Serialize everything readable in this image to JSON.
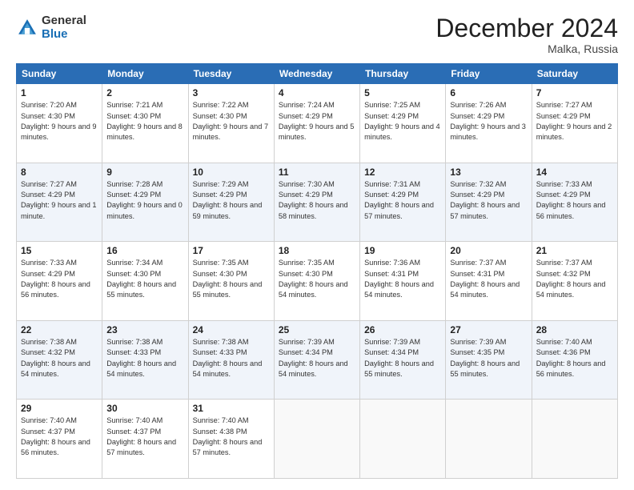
{
  "logo": {
    "general": "General",
    "blue": "Blue"
  },
  "header": {
    "title": "December 2024",
    "location": "Malka, Russia"
  },
  "weekdays": [
    "Sunday",
    "Monday",
    "Tuesday",
    "Wednesday",
    "Thursday",
    "Friday",
    "Saturday"
  ],
  "weeks": [
    [
      {
        "day": "1",
        "sunrise": "7:20 AM",
        "sunset": "4:30 PM",
        "daylight": "9 hours and 9 minutes."
      },
      {
        "day": "2",
        "sunrise": "7:21 AM",
        "sunset": "4:30 PM",
        "daylight": "9 hours and 8 minutes."
      },
      {
        "day": "3",
        "sunrise": "7:22 AM",
        "sunset": "4:30 PM",
        "daylight": "9 hours and 7 minutes."
      },
      {
        "day": "4",
        "sunrise": "7:24 AM",
        "sunset": "4:29 PM",
        "daylight": "9 hours and 5 minutes."
      },
      {
        "day": "5",
        "sunrise": "7:25 AM",
        "sunset": "4:29 PM",
        "daylight": "9 hours and 4 minutes."
      },
      {
        "day": "6",
        "sunrise": "7:26 AM",
        "sunset": "4:29 PM",
        "daylight": "9 hours and 3 minutes."
      },
      {
        "day": "7",
        "sunrise": "7:27 AM",
        "sunset": "4:29 PM",
        "daylight": "9 hours and 2 minutes."
      }
    ],
    [
      {
        "day": "8",
        "sunrise": "7:27 AM",
        "sunset": "4:29 PM",
        "daylight": "9 hours and 1 minute."
      },
      {
        "day": "9",
        "sunrise": "7:28 AM",
        "sunset": "4:29 PM",
        "daylight": "9 hours and 0 minutes."
      },
      {
        "day": "10",
        "sunrise": "7:29 AM",
        "sunset": "4:29 PM",
        "daylight": "8 hours and 59 minutes."
      },
      {
        "day": "11",
        "sunrise": "7:30 AM",
        "sunset": "4:29 PM",
        "daylight": "8 hours and 58 minutes."
      },
      {
        "day": "12",
        "sunrise": "7:31 AM",
        "sunset": "4:29 PM",
        "daylight": "8 hours and 57 minutes."
      },
      {
        "day": "13",
        "sunrise": "7:32 AM",
        "sunset": "4:29 PM",
        "daylight": "8 hours and 57 minutes."
      },
      {
        "day": "14",
        "sunrise": "7:33 AM",
        "sunset": "4:29 PM",
        "daylight": "8 hours and 56 minutes."
      }
    ],
    [
      {
        "day": "15",
        "sunrise": "7:33 AM",
        "sunset": "4:29 PM",
        "daylight": "8 hours and 56 minutes."
      },
      {
        "day": "16",
        "sunrise": "7:34 AM",
        "sunset": "4:30 PM",
        "daylight": "8 hours and 55 minutes."
      },
      {
        "day": "17",
        "sunrise": "7:35 AM",
        "sunset": "4:30 PM",
        "daylight": "8 hours and 55 minutes."
      },
      {
        "day": "18",
        "sunrise": "7:35 AM",
        "sunset": "4:30 PM",
        "daylight": "8 hours and 54 minutes."
      },
      {
        "day": "19",
        "sunrise": "7:36 AM",
        "sunset": "4:31 PM",
        "daylight": "8 hours and 54 minutes."
      },
      {
        "day": "20",
        "sunrise": "7:37 AM",
        "sunset": "4:31 PM",
        "daylight": "8 hours and 54 minutes."
      },
      {
        "day": "21",
        "sunrise": "7:37 AM",
        "sunset": "4:32 PM",
        "daylight": "8 hours and 54 minutes."
      }
    ],
    [
      {
        "day": "22",
        "sunrise": "7:38 AM",
        "sunset": "4:32 PM",
        "daylight": "8 hours and 54 minutes."
      },
      {
        "day": "23",
        "sunrise": "7:38 AM",
        "sunset": "4:33 PM",
        "daylight": "8 hours and 54 minutes."
      },
      {
        "day": "24",
        "sunrise": "7:38 AM",
        "sunset": "4:33 PM",
        "daylight": "8 hours and 54 minutes."
      },
      {
        "day": "25",
        "sunrise": "7:39 AM",
        "sunset": "4:34 PM",
        "daylight": "8 hours and 54 minutes."
      },
      {
        "day": "26",
        "sunrise": "7:39 AM",
        "sunset": "4:34 PM",
        "daylight": "8 hours and 55 minutes."
      },
      {
        "day": "27",
        "sunrise": "7:39 AM",
        "sunset": "4:35 PM",
        "daylight": "8 hours and 55 minutes."
      },
      {
        "day": "28",
        "sunrise": "7:40 AM",
        "sunset": "4:36 PM",
        "daylight": "8 hours and 56 minutes."
      }
    ],
    [
      {
        "day": "29",
        "sunrise": "7:40 AM",
        "sunset": "4:37 PM",
        "daylight": "8 hours and 56 minutes."
      },
      {
        "day": "30",
        "sunrise": "7:40 AM",
        "sunset": "4:37 PM",
        "daylight": "8 hours and 57 minutes."
      },
      {
        "day": "31",
        "sunrise": "7:40 AM",
        "sunset": "4:38 PM",
        "daylight": "8 hours and 57 minutes."
      },
      null,
      null,
      null,
      null
    ]
  ]
}
